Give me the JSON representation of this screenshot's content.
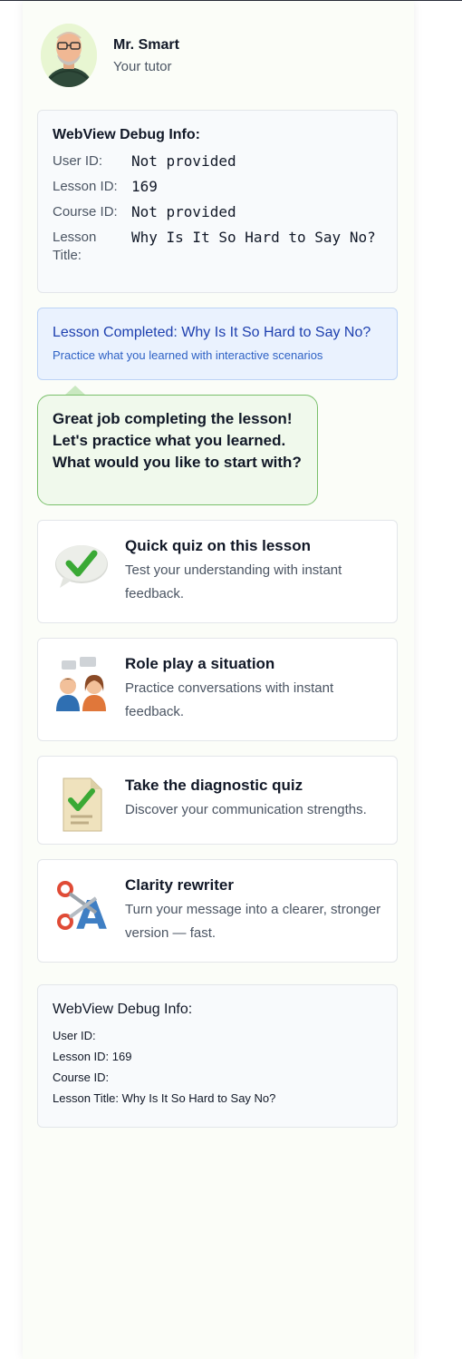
{
  "tutor": {
    "name": "Mr. Smart",
    "role": "Your tutor"
  },
  "debug_panel": {
    "title": "WebView Debug Info:",
    "rows": [
      {
        "label": "User ID:",
        "value": "Not provided"
      },
      {
        "label": "Lesson ID:",
        "value": "169"
      },
      {
        "label": "Course ID:",
        "value": "Not provided"
      },
      {
        "label": "Lesson Title:",
        "value": "Why Is It So Hard to Say No?"
      }
    ]
  },
  "lesson_banner": {
    "title": "Lesson Completed: Why Is It So Hard to Say No?",
    "subtitle": "Practice what you learned with interactive scenarios"
  },
  "chat_bubble": {
    "text": "Great job completing the lesson! Let's practice what you learned. What would you like to start with?"
  },
  "options": [
    {
      "title": "Quick quiz on this lesson",
      "desc": "Test your understanding with instant feedback.",
      "icon": "speech-bubble-check-icon"
    },
    {
      "title": "Role play a situation",
      "desc": "Practice conversations with instant feedback.",
      "icon": "two-people-chat-icon"
    },
    {
      "title": "Take the diagnostic quiz",
      "desc": "Discover your communication strengths.",
      "icon": "document-check-icon"
    },
    {
      "title": "Clarity rewriter",
      "desc": "Turn your message into a clearer, stronger version — fast.",
      "icon": "scissors-letter-icon"
    }
  ],
  "debug_footer": {
    "title": "WebView Debug Info:",
    "user_id": "User ID:",
    "lesson_id": "Lesson ID: 169",
    "course_id": "Course ID:",
    "lesson_title": "Lesson Title: Why Is It So Hard to Say No?"
  },
  "colors": {
    "panel_bg": "#fbfdf8",
    "accent_green": "#79c06b",
    "lesson_blue": "#1e40af"
  }
}
